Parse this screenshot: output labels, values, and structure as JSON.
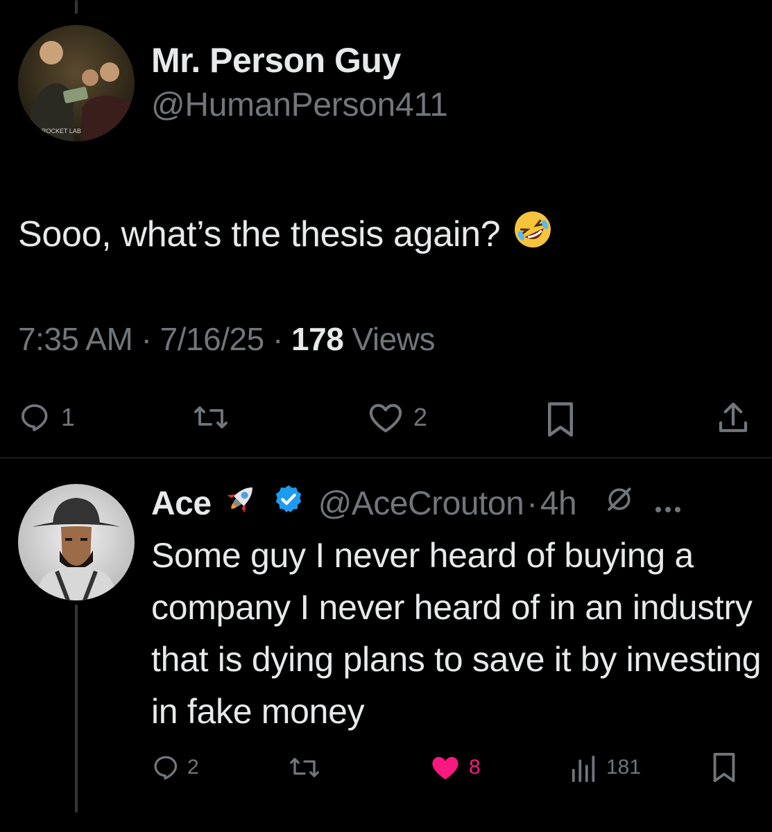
{
  "colors": {
    "background": "#000000",
    "primary_text": "#e7e9ea",
    "secondary_text": "#71767b",
    "like_active": "#f91880",
    "verified": "#1d9bf0"
  },
  "main_tweet": {
    "display_name": "Mr. Person Guy",
    "handle": "@HumanPerson411",
    "avatar_caption": "ROCKET LAB",
    "text": "Sooo, what’s the thesis again?",
    "emoji": "rolling-on-floor-laughing-emoji",
    "time": "7:35 AM",
    "separator": "·",
    "date": "7/16/25",
    "views_count": "178",
    "views_label": "Views",
    "actions": {
      "reply_count": "1",
      "retweet_count": "",
      "like_count": "2"
    },
    "icons": [
      "reply-icon",
      "retweet-icon",
      "like-icon",
      "bookmark-icon",
      "share-icon"
    ]
  },
  "reply_tweet": {
    "display_name": "Ace",
    "name_emoji": "rocket-emoji",
    "handle": "@AceCrouton",
    "separator": "·",
    "time_ago": "4h",
    "text": "Some guy I never heard of buying a company I never heard of in an industry that is dying plans to save it by investing in fake money",
    "actions": {
      "reply_count": "2",
      "retweet_count": "",
      "like_count": "8",
      "liked": true,
      "views_count": "181"
    },
    "icons": [
      "reply-icon",
      "retweet-icon",
      "like-icon-filled",
      "views-icon",
      "bookmark-icon",
      "grok-icon",
      "more-icon"
    ]
  }
}
